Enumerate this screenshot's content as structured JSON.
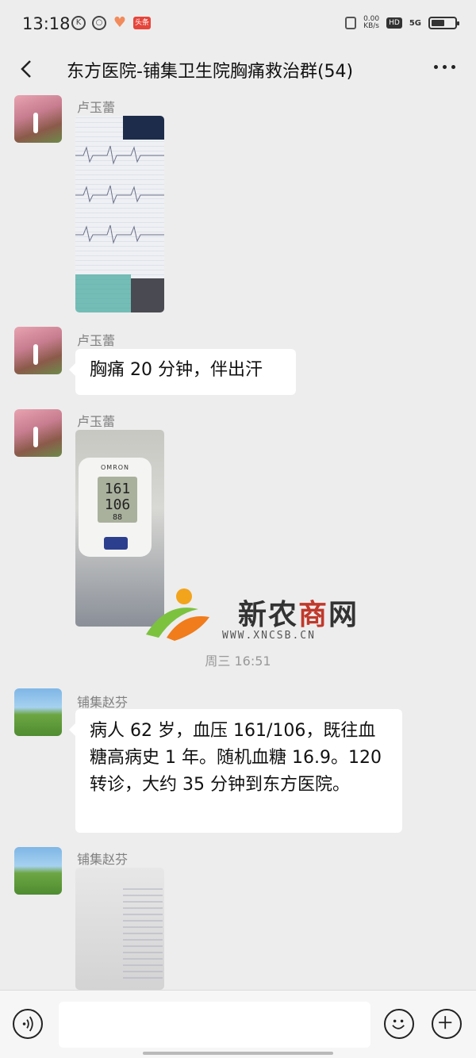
{
  "status": {
    "time": "13:18",
    "net_speed": "0.00",
    "net_unit": "KB/s",
    "hd": "HD",
    "network": "5G",
    "news_badge": "头条"
  },
  "header": {
    "title": "东方医院-铺集卫生院胸痛救治群(54)"
  },
  "messages": [
    {
      "sender": "卢玉蕾",
      "type": "image",
      "content": "ecg-photo"
    },
    {
      "sender": "卢玉蕾",
      "type": "text",
      "text": "胸痛 20 分钟，伴出汗"
    },
    {
      "sender": "卢玉蕾",
      "type": "image",
      "content": "blood-pressure-monitor-photo",
      "screen_values": [
        "161",
        "106",
        "88"
      ],
      "brand": "OMRON"
    },
    {
      "sender": "铺集赵芬",
      "type": "text",
      "text": "病人 62 岁，血压 161/106，既往血糖高病史 1 年。随机血糖 16.9。120 转诊，大约 35 分钟到东方医院。"
    },
    {
      "sender": "铺集赵芬",
      "type": "image",
      "content": "document-photo"
    }
  ],
  "timestamp": "周三  16:51",
  "watermark": {
    "title_a": "新农",
    "title_b": "商",
    "title_c": "网",
    "url": "WWW.XNCSB.CN"
  },
  "input": {
    "value": ""
  }
}
